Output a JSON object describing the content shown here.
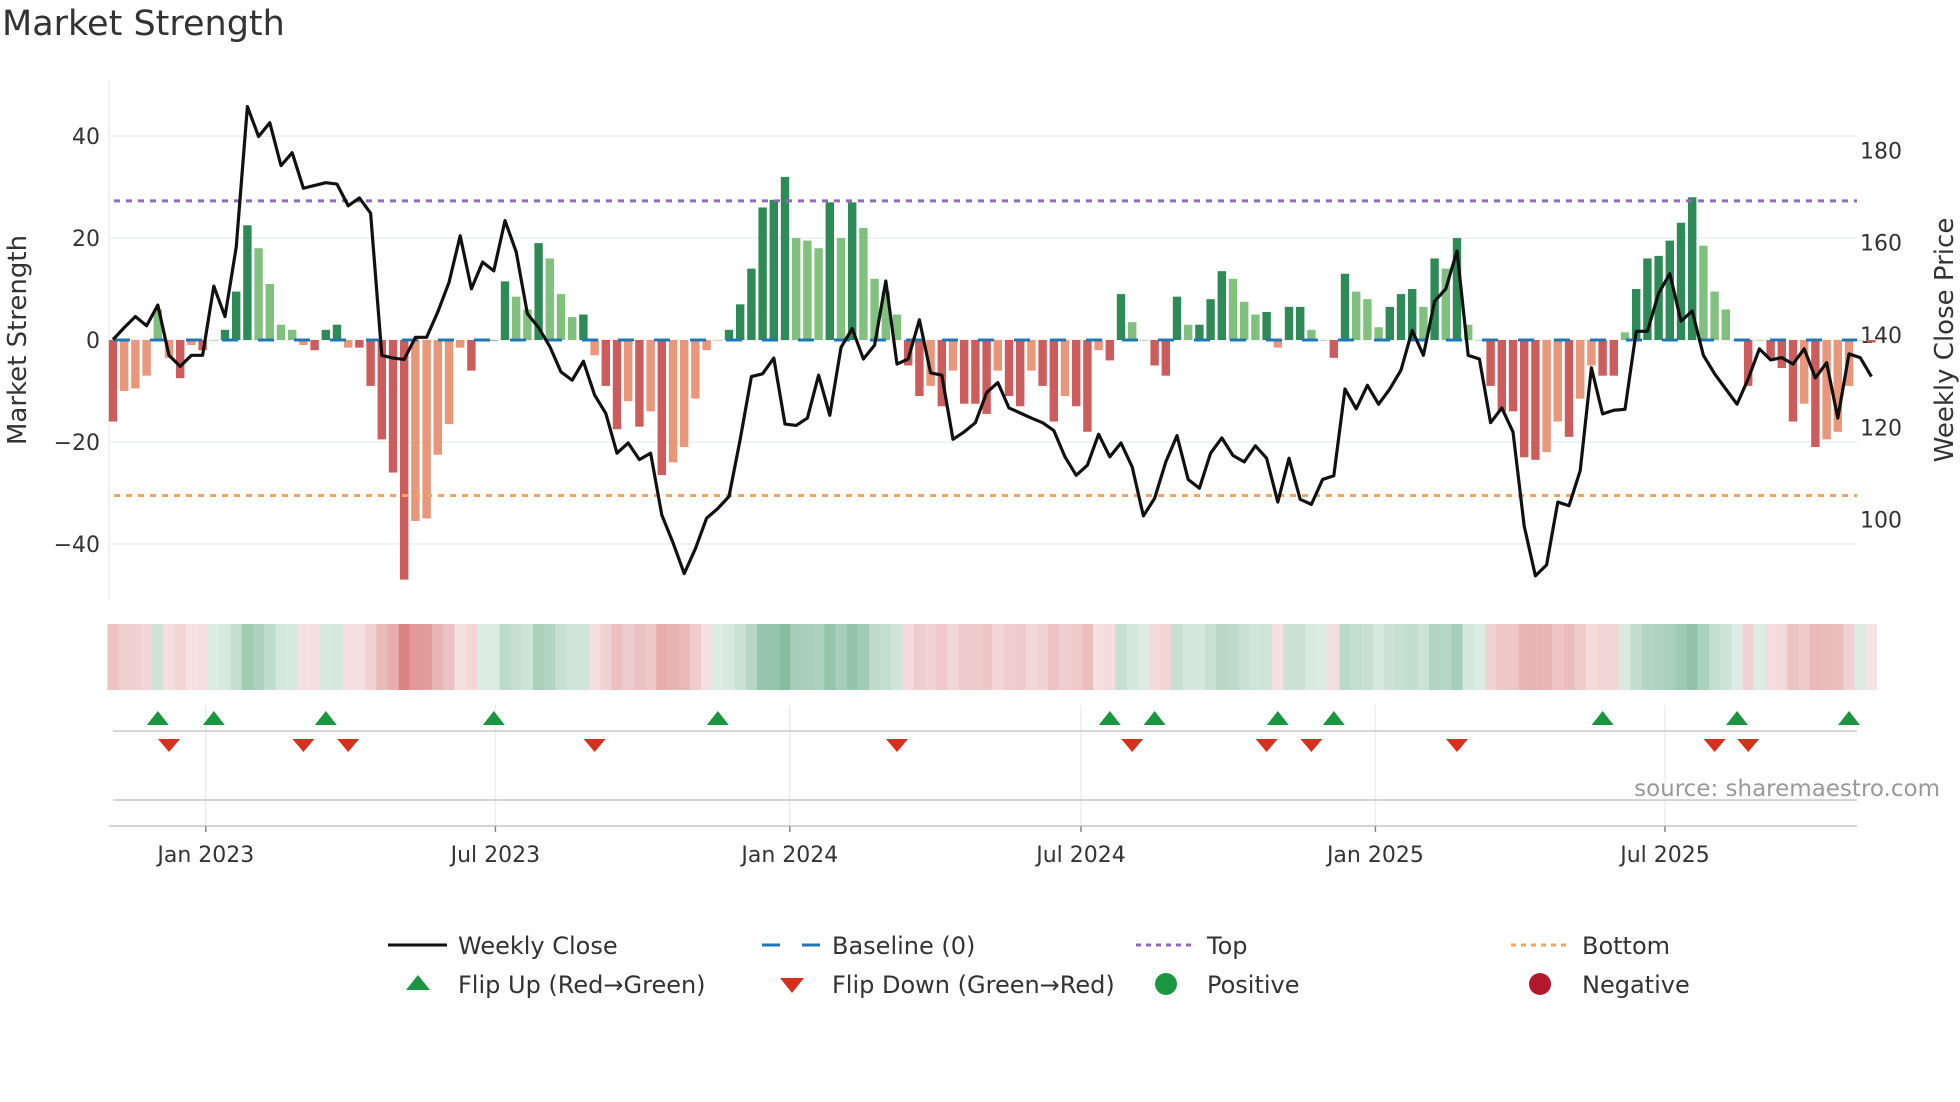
{
  "chart_data": {
    "type": "bar",
    "title": "Market Strength",
    "ylabel_left": "Market Strength",
    "ylabel_right": "Weekly Close Price",
    "start_date": "2022-11-04",
    "frequency": "weekly",
    "ylim_left": [
      -51,
      51
    ],
    "ylim_right": [
      82.6,
      195
    ],
    "left_yticks": [
      -40,
      -20,
      0,
      20,
      40
    ],
    "left_ytick_labels": [
      "−40",
      "−20",
      "0",
      "20",
      "40"
    ],
    "right_yticks": [
      100,
      120,
      140,
      160,
      180
    ],
    "right_ytick_labels": [
      "100",
      "120",
      "140",
      "160",
      "180"
    ],
    "xticks": [
      {
        "date": "2023-01-01",
        "label": "Jan 2023"
      },
      {
        "date": "2023-07-01",
        "label": "Jul 2023"
      },
      {
        "date": "2024-01-01",
        "label": "Jan 2024"
      },
      {
        "date": "2024-07-01",
        "label": "Jul 2024"
      },
      {
        "date": "2025-01-01",
        "label": "Jan 2025"
      },
      {
        "date": "2025-07-01",
        "label": "Jul 2025"
      }
    ],
    "baseline": 0,
    "top_level": 27.3,
    "bottom_level": -30.5,
    "strength": [
      -16,
      -10,
      -9.5,
      -7,
      6,
      -3.5,
      -7.5,
      -1,
      -2,
      0,
      2,
      9.5,
      22.5,
      18,
      11,
      3,
      2,
      -1,
      -2,
      2,
      3,
      -1.5,
      -1.5,
      -9,
      -19.5,
      -26,
      -47,
      -35.5,
      -35,
      -22.5,
      -16.5,
      -1.5,
      -6,
      0,
      0,
      11.5,
      8.5,
      6,
      19,
      16,
      9,
      4.5,
      5,
      -3,
      -9,
      -17.5,
      -12,
      -17,
      -14,
      -26.5,
      -24,
      -21,
      -11.5,
      -2,
      0,
      2,
      7,
      14,
      26,
      27.5,
      32,
      20,
      19.5,
      18,
      27,
      20,
      27,
      22,
      12,
      9.5,
      5,
      -5,
      -11,
      -9,
      -13,
      -6,
      -12.5,
      -12.5,
      -14.5,
      -6,
      -11,
      -13,
      -6,
      -9,
      -16,
      -11,
      -13,
      -18,
      -2,
      -4,
      9,
      3.5,
      0,
      -5,
      -7,
      8.5,
      3,
      3,
      8,
      13.5,
      12,
      7.5,
      5,
      5.5,
      -1.5,
      6.5,
      6.5,
      2,
      0,
      -3.5,
      13,
      9.5,
      8,
      2.5,
      6.5,
      9,
      10,
      6.5,
      16,
      14,
      20,
      3,
      0,
      -9,
      -14,
      -14,
      -23,
      -23.5,
      -22,
      -16,
      -19,
      -11.5,
      -5,
      -7,
      -7,
      1.5,
      10,
      16,
      16.5,
      19.5,
      23,
      28,
      18.5,
      9.5,
      6,
      0,
      -9,
      0,
      -3.5,
      -5.5,
      -16,
      -12.5,
      -21,
      -19.5,
      -18,
      -9,
      0,
      -0.5
    ],
    "close": [
      139,
      141.6,
      144,
      142,
      146.5,
      135.6,
      133.2,
      135.6,
      135.6,
      150.6,
      144,
      159,
      189.5,
      183,
      186,
      176.7,
      179.5,
      171.8,
      172.4,
      173,
      172.7,
      168,
      169.7,
      166.4,
      135.6,
      135,
      134.7,
      139.5,
      139.5,
      145,
      151.4,
      161.5,
      150,
      155.8,
      153.9,
      164.8,
      158,
      144.6,
      141.6,
      137.5,
      132,
      130.2,
      134.3,
      127,
      123,
      114.4,
      116.6,
      113,
      114.4,
      101,
      95,
      88.3,
      93.7,
      100.3,
      102.4,
      105,
      117.4,
      131,
      131.6,
      135,
      120.7,
      120.4,
      122,
      131.3,
      122.6,
      137.3,
      141.4,
      134.8,
      137.8,
      151.7,
      133.7,
      134.8,
      143.3,
      131.8,
      131.3,
      117.4,
      119,
      121,
      127.5,
      129.7,
      124.2,
      123.1,
      122,
      121,
      119.3,
      113.6,
      109.6,
      111.8,
      118.5,
      113.6,
      116.6,
      111.4,
      100.8,
      104.6,
      112.5,
      118.2,
      108.7,
      106.8,
      114.4,
      117.7,
      113.9,
      112.5,
      116,
      113.3,
      103.8,
      113.3,
      104.4,
      103.3,
      108.7,
      109.5,
      128.3,
      124,
      129.1,
      125,
      128.3,
      132.4,
      141,
      135.6,
      147.3,
      150,
      158.2,
      135.6,
      134.8,
      121,
      124.2,
      119,
      98.6,
      87.8,
      90.2,
      103.8,
      103,
      110.6,
      132.9,
      122.9,
      123.7,
      123.9,
      140.8,
      140.8,
      149,
      153.3,
      143,
      145.2,
      135.6,
      131.6,
      128.3,
      125,
      130.5,
      137,
      134.6,
      135.1,
      133.7,
      137,
      130.7,
      134,
      122,
      135.9,
      135.1,
      131
    ],
    "flip_up_dates": [
      "2022-12-02",
      "2023-01-06",
      "2023-03-17",
      "2023-06-30",
      "2023-11-17",
      "2024-07-19",
      "2024-08-16",
      "2024-11-01",
      "2024-12-06",
      "2025-05-23",
      "2025-08-15",
      "2025-10-24"
    ],
    "flip_down_dates": [
      "2022-12-09",
      "2023-03-03",
      "2023-03-31",
      "2023-09-01",
      "2024-03-08",
      "2024-08-02",
      "2024-10-25",
      "2024-11-22",
      "2025-02-21",
      "2025-08-01",
      "2025-08-22"
    ],
    "legend": {
      "weekly_close": "Weekly Close",
      "baseline": "Baseline (0)",
      "top": "Top",
      "bottom": "Bottom",
      "flip_up": "Flip Up (Red→Green)",
      "flip_down": "Flip Down (Green→Red)",
      "positive": "Positive",
      "negative": "Negative"
    },
    "source": "source: sharemaestro.com"
  },
  "colors": {
    "green_dark": "#2e8b57",
    "green_light": "#81c07f",
    "red_dark": "#cd5c5c",
    "red_light": "#e9967a",
    "baseline": "#1f77b4",
    "top": "#9467bd",
    "bottom": "#f4a460",
    "close": "#111111",
    "flip_up": "#1a9641",
    "flip_down": "#d7301f",
    "positive": "#1a9641",
    "negative": "#b2182b"
  }
}
